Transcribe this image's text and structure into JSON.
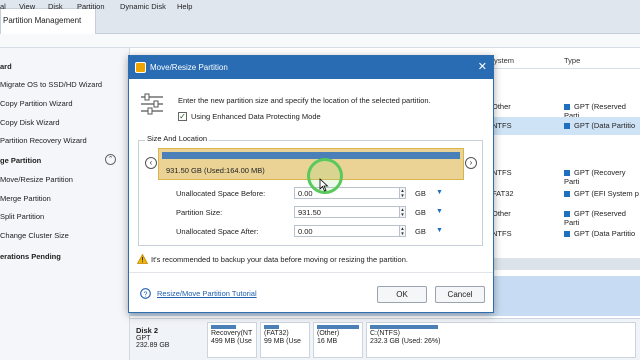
{
  "app": {
    "tab_title": "Partition Management"
  },
  "menu": [
    "al",
    "View",
    "Disk",
    "Partition",
    "Dynamic Disk",
    "Help"
  ],
  "sidebar": {
    "heading1": "ard",
    "items1": [
      "Migrate OS to SSD/HD Wizard",
      "Copy Partition Wizard",
      "Copy Disk Wizard",
      "Partition Recovery Wizard"
    ],
    "heading2": "ge Partition",
    "items2": [
      "Move/Resize Partition",
      "Merge Partition",
      "Split Partition",
      "Change Cluster Size"
    ],
    "heading3": "erations Pending",
    "collapse_glyph": "⌃"
  },
  "table": {
    "col_filesystem": "ystem",
    "col_type": "Type",
    "rows": [
      {
        "fs": "Other",
        "type": "GPT (Reserved Parti"
      },
      {
        "fs": "NTFS",
        "type": "GPT (Data Partitio"
      },
      {
        "fs": "NTFS",
        "type": "GPT (Recovery Parti"
      },
      {
        "fs": "FAT32",
        "type": "GPT (EFI System p"
      },
      {
        "fs": "Other",
        "type": "GPT (Reserved Parti"
      },
      {
        "fs": "NTFS",
        "type": "GPT (Data Partitio"
      }
    ]
  },
  "diskmap": {
    "disk_name": "Disk 2",
    "disk_type": "GPT",
    "disk_size": "232.89 GB",
    "parts": [
      {
        "line1": "Recovery(NT",
        "line2": "499 MB (Use"
      },
      {
        "line1": "(FAT32)",
        "line2": "99 MB (Use"
      },
      {
        "line1": "(Other)",
        "line2": "16 MB"
      },
      {
        "line1": "C:(NTFS)",
        "line2": "232.3 GB (Used: 26%)"
      }
    ]
  },
  "dialog": {
    "title": "Move/Resize Partition",
    "close": "✕",
    "instruction": "Enter the new partition size and specify the location of the selected partition.",
    "checkbox_label": "Using Enhanced Data Protecting Mode",
    "checkbox_checked": true,
    "group_label": "Size And Location",
    "partition_label": "931.50 GB (Used:164.00 MB)",
    "nav_left": "‹",
    "nav_right": "›",
    "fields": {
      "before_label": "Unallocated Space Before:",
      "before_value": "0.00",
      "size_label": "Partition Size:",
      "size_value": "931.50",
      "after_label": "Unallocated Space After:",
      "after_value": "0.00",
      "unit": "GB",
      "spin_up": "▲",
      "spin_down": "▼",
      "dropdown": "▼"
    },
    "warning": "It's recommended to backup your data before moving or resizing the partition.",
    "tutorial_link": "Resize/Move Partition Tutorial",
    "ok": "OK",
    "cancel": "Cancel"
  }
}
